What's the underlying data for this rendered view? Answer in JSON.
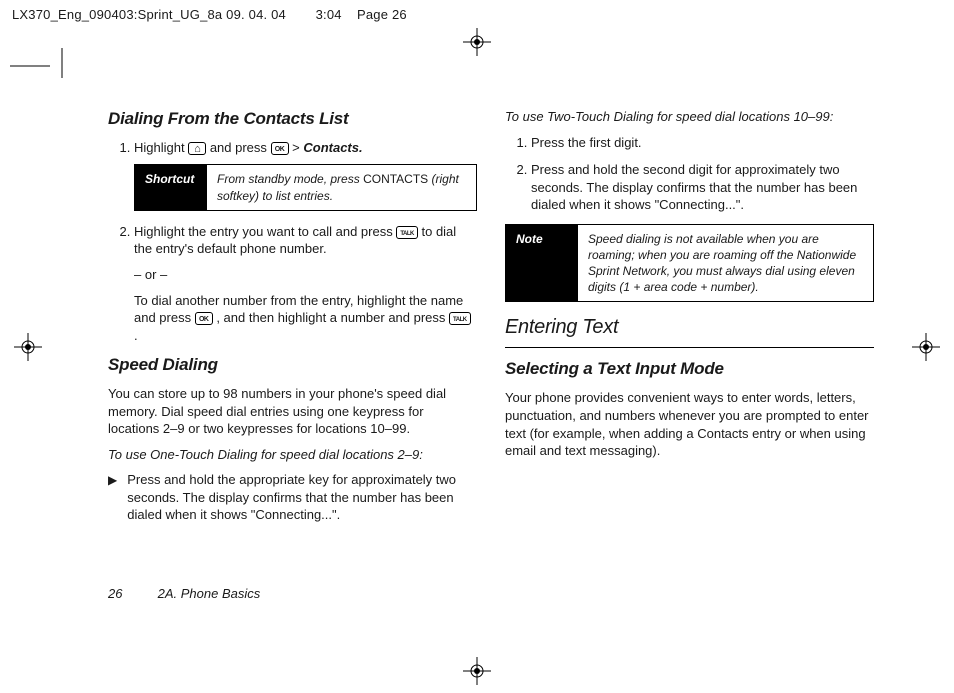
{
  "header": {
    "prepress": "LX370_Eng_090403:Sprint_UG_8a  09. 04. 04",
    "time": "3:04",
    "page": "Page 26"
  },
  "left": {
    "h2_dialing": "Dialing From the Contacts List",
    "step1_a": "Highlight ",
    "step1_b": " and press ",
    "step1_c": " > ",
    "step1_d": "Contacts.",
    "shortcut_tag": "Shortcut",
    "shortcut_txt_a": "From standby mode, press ",
    "shortcut_txt_b": "CONTACTS",
    "shortcut_txt_c": " (right softkey) to list entries.",
    "step2_a": "Highlight the entry you want to call and press ",
    "step2_b": " to dial the entry's default phone number.",
    "or": "– or –",
    "step2_c": "To dial another number from the entry, highlight the name and press ",
    "step2_d": " , and then highlight a number and press ",
    "step2_e": " .",
    "h2_speed": "Speed Dialing",
    "speed_p": "You can store up to 98 numbers in your phone's speed dial memory. Dial speed dial entries using one keypress for locations 2–9 or two keypresses for locations 10–99.",
    "one_touch_h": "To use One-Touch Dialing for speed dial locations 2–9:",
    "one_touch_b": "Press and hold the appropriate key for approximately two seconds. The display confirms that the number has been dialed when it shows \"Connecting...\"."
  },
  "right": {
    "two_touch_h": "To use Two-Touch Dialing for speed dial locations 10–99:",
    "tt_s1": "Press the first digit.",
    "tt_s2": "Press and hold the second digit for approximately two seconds. The display confirms that the number has been dialed when it shows \"Connecting...\".",
    "note_tag": "Note",
    "note_txt": "Speed dialing is not available when you are roaming; when you are roaming off the Nationwide Sprint Network, you must always dial using eleven digits (1 + area code + number).",
    "h1_enter": "Entering Text",
    "h2_select": "Selecting a Text Input Mode",
    "select_p": "Your phone provides convenient ways to enter words, letters, punctuation, and numbers whenever you are prompted to enter text (for example, when adding a Contacts entry or when using email and text messaging)."
  },
  "footer": {
    "page_num": "26",
    "section": "2A. Phone Basics"
  }
}
